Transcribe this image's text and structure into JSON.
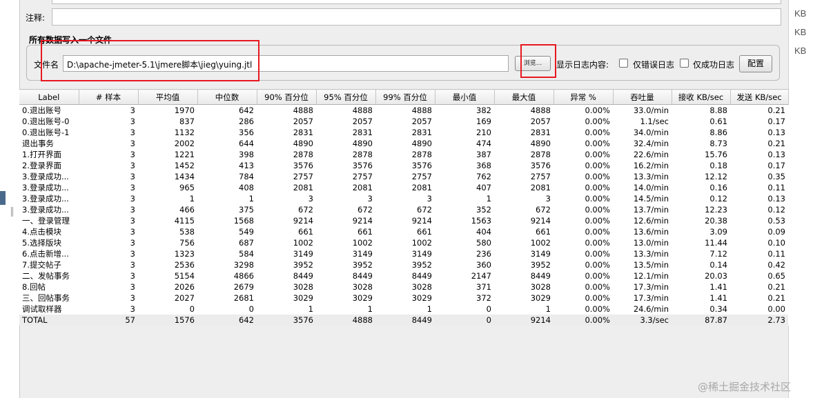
{
  "comment_label": "注释:",
  "write_all_label": "所有数据写入一个文件",
  "filename_label": "文件名",
  "filename_value": "D:\\apache-jmeter-5.1\\jmere脚本\\jieg\\yuing.jtl",
  "browse_label": "浏览...",
  "show_log_label": "显示日志内容:",
  "errors_only_label": "仅错误日志",
  "success_only_label": "仅成功日志",
  "config_label": "配置",
  "side_kb": [
    "KB",
    "KB",
    "KB"
  ],
  "watermark": "@稀土掘金技术社区",
  "colors": {
    "annotation": "#e8171f",
    "panel": "#eeeeee"
  },
  "table": {
    "headers": [
      "Label",
      "# 样本",
      "平均值",
      "中位数",
      "90% 百分位",
      "95% 百分位",
      "99% 百分位",
      "最小值",
      "最大值",
      "异常 %",
      "吞吐量",
      "接收 KB/sec",
      "发送 KB/sec"
    ],
    "rows": [
      [
        "0.退出账号",
        "3",
        "1970",
        "642",
        "4888",
        "4888",
        "4888",
        "382",
        "4888",
        "0.00%",
        "33.0/min",
        "8.88",
        "0.21"
      ],
      [
        "0.退出账号-0",
        "3",
        "837",
        "286",
        "2057",
        "2057",
        "2057",
        "169",
        "2057",
        "0.00%",
        "1.1/sec",
        "0.61",
        "0.17"
      ],
      [
        "0.退出账号-1",
        "3",
        "1132",
        "356",
        "2831",
        "2831",
        "2831",
        "210",
        "2831",
        "0.00%",
        "34.0/min",
        "8.86",
        "0.13"
      ],
      [
        "退出事务",
        "3",
        "2002",
        "644",
        "4890",
        "4890",
        "4890",
        "474",
        "4890",
        "0.00%",
        "32.4/min",
        "8.73",
        "0.21"
      ],
      [
        "1.打开界面",
        "3",
        "1221",
        "398",
        "2878",
        "2878",
        "2878",
        "387",
        "2878",
        "0.00%",
        "22.6/min",
        "15.76",
        "0.13"
      ],
      [
        "2.登录界面",
        "3",
        "1452",
        "413",
        "3576",
        "3576",
        "3576",
        "368",
        "3576",
        "0.00%",
        "16.2/min",
        "0.18",
        "0.17"
      ],
      [
        "3.登录成功...",
        "3",
        "1434",
        "784",
        "2757",
        "2757",
        "2757",
        "762",
        "2757",
        "0.00%",
        "13.3/min",
        "12.12",
        "0.35"
      ],
      [
        "3.登录成功...",
        "3",
        "965",
        "408",
        "2081",
        "2081",
        "2081",
        "407",
        "2081",
        "0.00%",
        "14.0/min",
        "0.16",
        "0.11"
      ],
      [
        "3.登录成功...",
        "3",
        "1",
        "1",
        "3",
        "3",
        "3",
        "1",
        "3",
        "0.00%",
        "14.5/min",
        "0.12",
        "0.13"
      ],
      [
        "3.登录成功...",
        "3",
        "466",
        "375",
        "672",
        "672",
        "672",
        "352",
        "672",
        "0.00%",
        "13.7/min",
        "12.23",
        "0.12"
      ],
      [
        "一、登录管理",
        "3",
        "4115",
        "1568",
        "9214",
        "9214",
        "9214",
        "1563",
        "9214",
        "0.00%",
        "12.6/min",
        "20.38",
        "0.53"
      ],
      [
        "4.点击模块",
        "3",
        "538",
        "549",
        "661",
        "661",
        "661",
        "404",
        "661",
        "0.00%",
        "13.6/min",
        "3.09",
        "0.09"
      ],
      [
        "5.选择版块",
        "3",
        "756",
        "687",
        "1002",
        "1002",
        "1002",
        "580",
        "1002",
        "0.00%",
        "13.0/min",
        "11.44",
        "0.10"
      ],
      [
        "6.点击新增...",
        "3",
        "1323",
        "584",
        "3149",
        "3149",
        "3149",
        "236",
        "3149",
        "0.00%",
        "13.3/min",
        "7.12",
        "0.11"
      ],
      [
        "7.提交帖子",
        "3",
        "2536",
        "3298",
        "3952",
        "3952",
        "3952",
        "360",
        "3952",
        "0.00%",
        "13.5/min",
        "0.14",
        "0.42"
      ],
      [
        "二、发帖事务",
        "3",
        "5154",
        "4866",
        "8449",
        "8449",
        "8449",
        "2147",
        "8449",
        "0.00%",
        "12.1/min",
        "20.03",
        "0.65"
      ],
      [
        "8.回帖",
        "3",
        "2026",
        "2679",
        "3028",
        "3028",
        "3028",
        "371",
        "3028",
        "0.00%",
        "17.3/min",
        "1.41",
        "0.21"
      ],
      [
        "三、回帖事务",
        "3",
        "2027",
        "2681",
        "3029",
        "3029",
        "3029",
        "372",
        "3029",
        "0.00%",
        "17.3/min",
        "1.41",
        "0.21"
      ],
      [
        "调试取样器",
        "3",
        "0",
        "0",
        "1",
        "1",
        "1",
        "0",
        "1",
        "0.00%",
        "24.6/min",
        "0.34",
        "0.00"
      ],
      [
        "TOTAL",
        "57",
        "1576",
        "642",
        "3576",
        "4888",
        "8449",
        "0",
        "9214",
        "0.00%",
        "3.3/sec",
        "87.87",
        "2.73"
      ]
    ]
  }
}
